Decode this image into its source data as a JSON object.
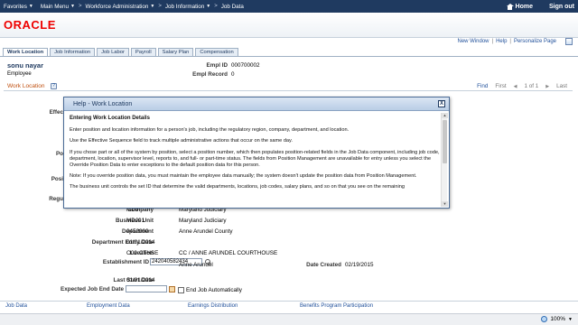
{
  "nav": {
    "favorites": "Favorites",
    "main_menu": "Main Menu",
    "workforce_admin": "Workforce Administration",
    "job_information": "Job Information",
    "job_data": "Job Data",
    "home": "Home",
    "sign_out": "Sign out",
    "sep": ">"
  },
  "brand": {
    "logo": "ORACLE",
    "logo_color": "#ee0000"
  },
  "toplinks": {
    "new_window": "New Window",
    "help": "Help",
    "personalize": "Personalize Page",
    "bar": "|"
  },
  "tabs": [
    "Work Location",
    "Job Information",
    "Job Labor",
    "Payroll",
    "Salary Plan",
    "Compensation"
  ],
  "employee": {
    "name": "sonu nayar",
    "role": "Employee",
    "empl_id_label": "Empl ID",
    "empl_id": "000700002",
    "empl_record_label": "Empl Record",
    "empl_record": "0"
  },
  "section": {
    "title": "Work Location",
    "find": "Find",
    "first": "First",
    "of": "1 of 1",
    "last": "Last"
  },
  "form": {
    "effec_label": "Effec",
    "po_label": "Po",
    "posi_label": "Posi",
    "regu_label": "Regu",
    "company_label": "Company",
    "company": "MDJ",
    "company_desc": "Maryland Judiciary",
    "business_unit_label": "Business Unit",
    "business_unit": "MDJ01",
    "business_unit_desc": "Maryland Judiciary",
    "department_label": "Department",
    "department": "0452000",
    "department_desc": "Anne Arundel County",
    "dept_entry_date_label": "Department Entry Date",
    "dept_entry_date": "01/01/2014",
    "location_label": "Location",
    "location": "O02-CTHSE",
    "location_desc": "CC / ANNE ARUNDEL COURTHOUSE",
    "establishment_label": "Establishment ID",
    "establishment": "242040582434",
    "establishment_desc": "Anne Arundel",
    "date_created_label": "Date Created",
    "date_created": "02/19/2015",
    "last_start_label": "Last Start Date",
    "last_start": "01/01/2014",
    "expected_end_label": "Expected Job End Date",
    "expected_end": "",
    "end_job_auto": "End Job Automatically"
  },
  "bottom_tabs": [
    "Job Data",
    "Employment Data",
    "Earnings Distribution",
    "Benefits Program Participation"
  ],
  "status": {
    "zoom": "100%"
  },
  "modal": {
    "title": "Help - Work Location",
    "close": "X",
    "heading": "Entering Work Location Details",
    "paragraphs": [
      "Enter position and location information for a person's job, including the regulatory region, company, department, and location.",
      "Use the Effective Sequence field to track multiple administrative actions that occur on the same day.",
      "If you chose part or all of the system by position, select a position number, which then populates position-related fields in the Job Data component, including job code, department, location, supervisor level, reports to, and full- or part-time status. The fields from Position Management are unavailable for entry unless you select the Override Position Data to enter exceptions to the default position data for this person.",
      "Note: If you override position data, you must maintain the employee data manually; the system doesn't update the position data from Position Management.",
      "The business unit controls the set ID that determine the valid departments, locations, job codes, salary plans, and so on that you see on the remaining"
    ]
  }
}
